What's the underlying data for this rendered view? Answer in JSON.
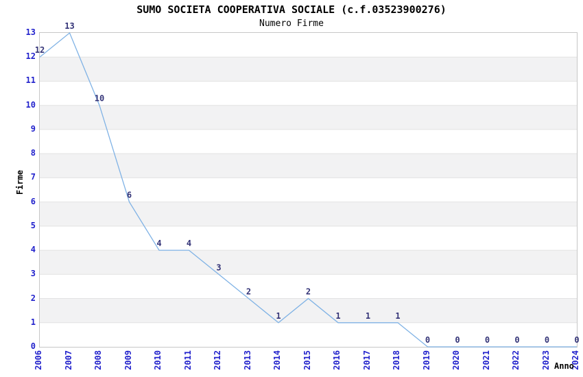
{
  "chart_data": {
    "type": "line",
    "title": "SUMO SOCIETA COOPERATIVA SOCIALE (c.f.03523900276)",
    "subtitle": "Numero Firme",
    "xlabel": "Anno",
    "ylabel": "Firme",
    "x": [
      2006,
      2007,
      2008,
      2009,
      2010,
      2011,
      2012,
      2013,
      2014,
      2015,
      2016,
      2017,
      2018,
      2019,
      2020,
      2021,
      2022,
      2023,
      2024
    ],
    "values": [
      12,
      13,
      10,
      6,
      4,
      4,
      3,
      2,
      1,
      2,
      1,
      1,
      1,
      0,
      0,
      0,
      0,
      0,
      0
    ],
    "ylim": [
      0,
      13
    ],
    "ytick_step": 1,
    "point_labels_visible": true,
    "legend_position": "none",
    "grid": "horizontal alternating bands",
    "colors": {
      "line": "#7fb2e5",
      "tick_label": "#2222cc",
      "point_label": "#333377",
      "band": "#f2f2f3",
      "gridline": "#e2e2e2",
      "axis_border": "#c6c6c6",
      "text": "#000000",
      "background": "#ffffff"
    }
  }
}
